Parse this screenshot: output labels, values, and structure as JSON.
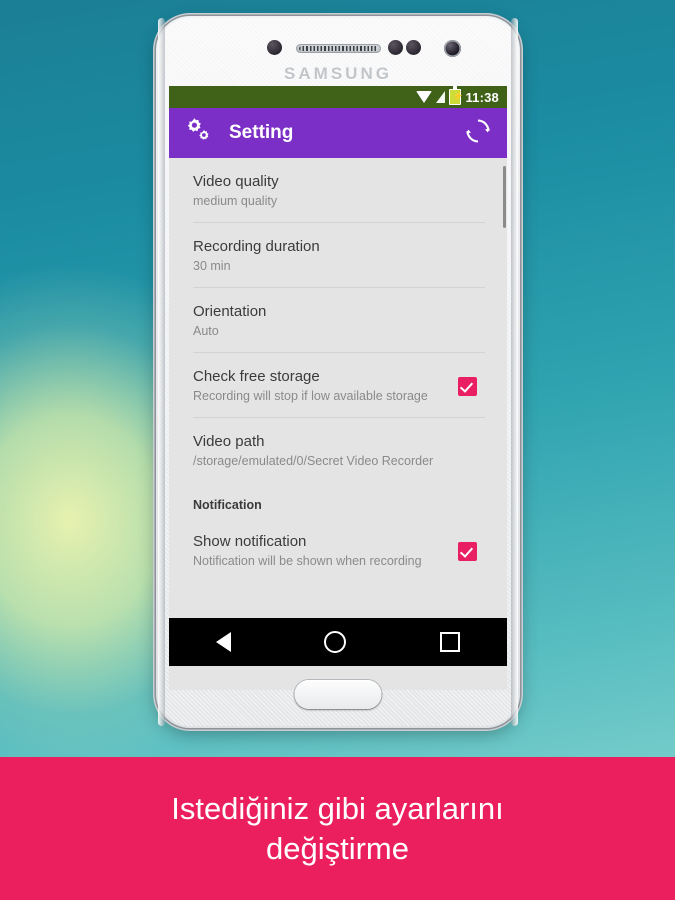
{
  "device": {
    "brand": "SAMSUNG"
  },
  "status_bar": {
    "time": "11:38",
    "icons": [
      "wifi-icon",
      "signal-icon",
      "battery-charging-icon"
    ],
    "background_color": "#3F6118"
  },
  "app_bar": {
    "title": "Setting",
    "left_icon": "settings-gears-icon",
    "right_icon": "refresh-icon",
    "background_color": "#7B2FC7"
  },
  "settings": {
    "items": [
      {
        "title": "Video quality",
        "subtitle": "medium quality",
        "checkbox": false
      },
      {
        "title": "Recording duration",
        "subtitle": "30 min",
        "checkbox": false
      },
      {
        "title": "Orientation",
        "subtitle": "Auto",
        "checkbox": false
      },
      {
        "title": "Check free storage",
        "subtitle": "Recording will stop if low available storage",
        "checkbox": true
      },
      {
        "title": "Video path",
        "subtitle": "/storage/emulated/0/Secret Video Recorder",
        "checkbox": false
      }
    ],
    "section_header": "Notification",
    "notification_items": [
      {
        "title": "Show notification",
        "subtitle": "Notification will be shown when recording",
        "checkbox": true
      }
    ],
    "checkbox_color": "#EA1E63",
    "background_color": "#E4E4E4"
  },
  "nav_bar": {
    "buttons": [
      "back-icon",
      "home-icon",
      "recents-icon"
    ],
    "background_color": "#000000"
  },
  "banner": {
    "line1": "Istediğiniz gibi ayarlarını",
    "line2": "değiştirme",
    "background_color": "#EC1F5E",
    "text_color": "#FFFFFF"
  }
}
